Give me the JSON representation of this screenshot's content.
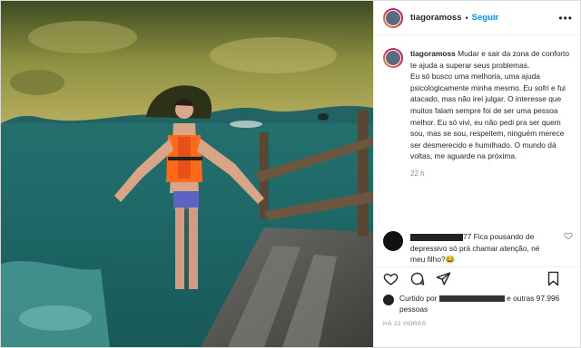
{
  "post": {
    "username": "tiagoramoss",
    "follow_label": "Seguir",
    "more_label": "•••",
    "caption": "Mudar e sair da zona de conforto te ajuda a superar seus problemas.\nEu só busco uma melhoria, uma ajuda psicologicamente minha mesmo. Eu sofri e fui atacado, mas não irei julgar. O interesse que muitos falam sempre foi de ser uma pessoa melhor. Eu só vivi, eu não pedi pra ser quem sou, mas se sou, respeitem, ninguém merece ser desmerecido e humilhado. O mundo dá voltas, me aguarde na próxima.",
    "caption_time": "22 h",
    "comment": {
      "suffix": "77 Fica pousando de depressivo só prá chamar atenção, né meu filho?😂"
    },
    "likes": {
      "prefix": "Curtido por",
      "suffix": "e outras 97.996 pessoas"
    },
    "posted_ago": "HÁ 22 HORAS"
  },
  "colors": {
    "accent": "#0095f6",
    "muted": "#8e8e8e",
    "text": "#262626"
  }
}
